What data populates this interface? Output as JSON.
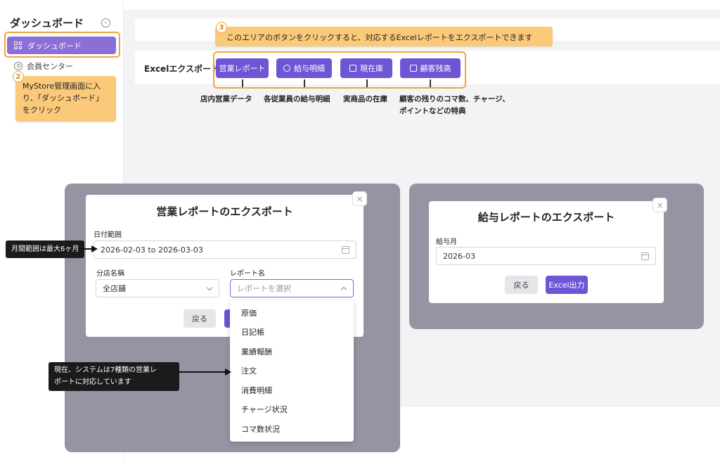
{
  "sidebar": {
    "title": "ダッシュボード",
    "active_item": "ダッシュボード",
    "items": [
      {
        "label": "会員センター"
      }
    ]
  },
  "export_bar": {
    "label": "Excelエクスポート",
    "buttons": [
      {
        "label": "営業レポート",
        "description": "店内営業データ"
      },
      {
        "label": "給与明細",
        "description": "各従業員の給与明細"
      },
      {
        "label": "現在庫",
        "description": "実商品の在庫"
      },
      {
        "label": "顧客残高",
        "description_line1": "顧客の残りのコマ数、チャージ、",
        "description_line2": "ポイントなどの特典"
      }
    ]
  },
  "callouts": {
    "step2": {
      "number": "2",
      "line1": "MyStore管理画面に入",
      "line2": "り、「ダッシュボード」",
      "line3": "をクリック"
    },
    "step3": {
      "number": "3",
      "text": "このエリアのボタンをクリックすると、対応するExcelレポートをエクスポートできます"
    },
    "month_range": "月間範囲は最大6ヶ月",
    "report_types_line1": "現在、システムは7種類の営業レ",
    "report_types_line2": "ポートに対応しています"
  },
  "sales_modal": {
    "title": "営業レポートのエクスポート",
    "date_label": "日付範囲",
    "date_value": "2026-02-03 to 2026-03-03",
    "store_label": "分店名稱",
    "store_value": "全店舗",
    "report_label": "レポート名",
    "report_placeholder": "レポートを選択",
    "back_label": "戻る",
    "close_glyph": "×",
    "report_options": [
      "原価",
      "日記帳",
      "業績報酬",
      "注文",
      "消費明細",
      "チャージ状況",
      "コマ数状況"
    ]
  },
  "salary_modal": {
    "title": "給与レポートのエクスポート",
    "month_label": "給与月",
    "month_value": "2026-03",
    "back_label": "戻る",
    "export_label": "Excel出力",
    "close_glyph": "×"
  },
  "colors": {
    "accent": "#6d55d6",
    "sidebar_active": "#8a6fd6",
    "callout": "#fbc97a",
    "highlight_outline": "#f1a43a",
    "overlay": "#9694a3"
  }
}
